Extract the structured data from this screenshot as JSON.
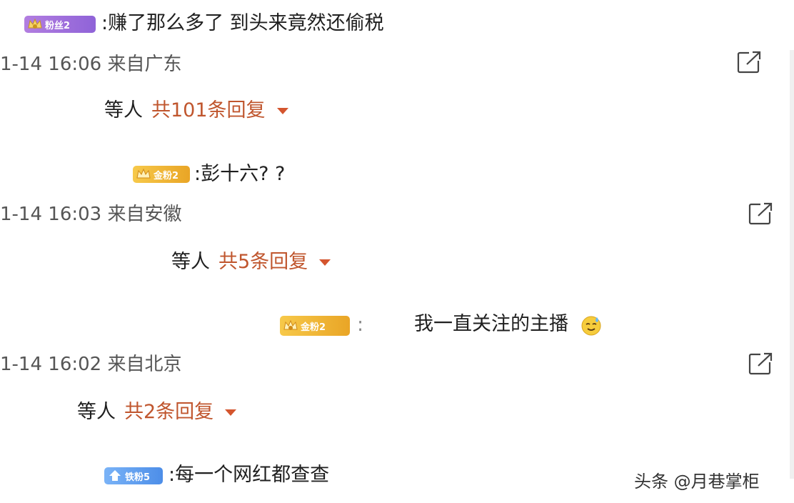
{
  "comments": [
    {
      "badge_text": "粉丝2",
      "badge_color": "#a374dc",
      "text": ":赚了那么多了 到头来竟然还偷税",
      "meta": "1-14 16:06 来自广东",
      "replies_who": "等人",
      "replies_count": "共101条回复"
    },
    {
      "badge_text": "金粉2",
      "badge_color": "#f0b83a",
      "text": ":彭十六? ?",
      "meta": "1-14 16:03 来自安徽",
      "replies_who": "等人",
      "replies_count": "共5条回复"
    },
    {
      "badge_text": "金粉2",
      "badge_color": "#f0b83a",
      "prefix": ":",
      "text": "我一直关注的主播",
      "emoji": "sweat-smile-emoji",
      "meta": "1-14 16:02 来自北京",
      "replies_who": "等人",
      "replies_count": "共2条回复"
    },
    {
      "badge_text": "铁粉5",
      "badge_color": "#5a9aee",
      "text": ":每一个网红都查查"
    }
  ],
  "watermark": "头条 @月巷掌柜",
  "icons": {
    "share": "share-external-icon",
    "caret": "caret-down-icon",
    "crown": "crown-icon"
  },
  "colors": {
    "reply_count": "#c0562e",
    "caret": "#d4552e",
    "meta": "#555555"
  }
}
